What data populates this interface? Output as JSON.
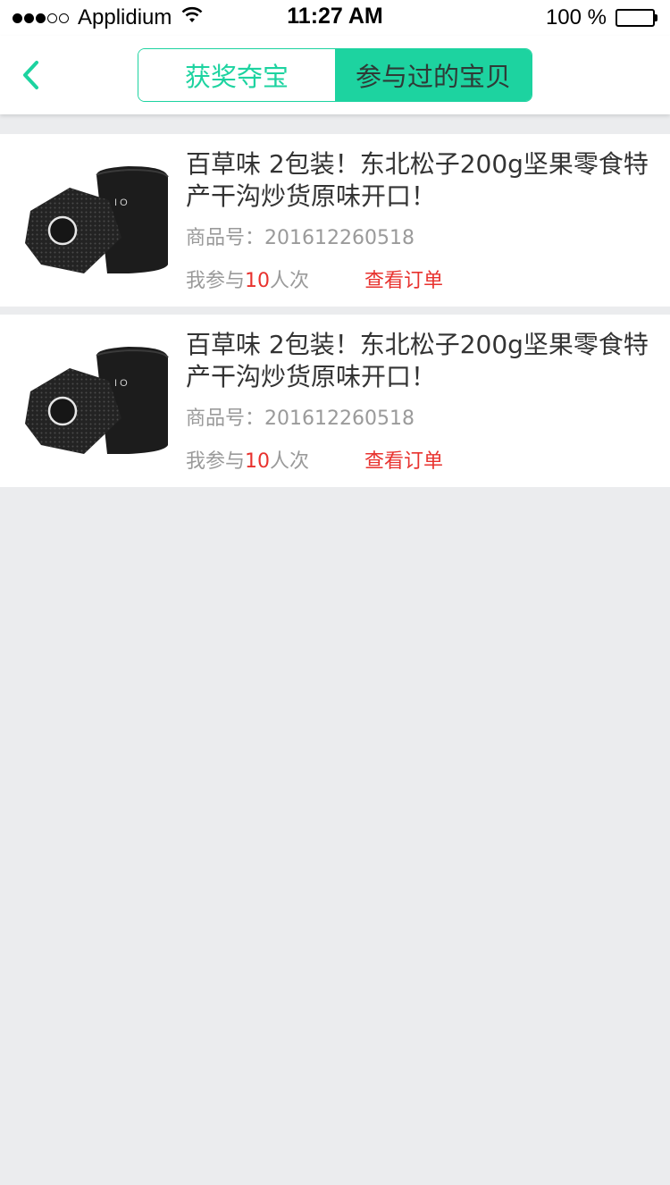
{
  "status_bar": {
    "carrier": "Applidium",
    "time": "11:27 AM",
    "battery": "100 %",
    "signal_bars_filled": 3,
    "signal_bars_total": 5
  },
  "nav": {
    "tabs": [
      {
        "label": "获奖夺宝",
        "active": false
      },
      {
        "label": "参与过的宝贝",
        "active": true
      }
    ],
    "accent_color": "#1dd3a0"
  },
  "items": [
    {
      "title": "百草味 2包装！东北松子200g坚果零食特产干沟炒货原味开口！",
      "code_label": "商品号：",
      "code": "201612260518",
      "participate_prefix": "我参与 ",
      "participate_count": "10",
      "participate_suffix": "人次",
      "order_link": "查看订单"
    },
    {
      "title": "百草味 2包装！东北松子200g坚果零食特产干沟炒货原味开口！",
      "code_label": "商品号：",
      "code": "201612260518",
      "participate_prefix": "我参与 ",
      "participate_count": "10",
      "participate_suffix": "人次",
      "order_link": "查看订单"
    }
  ],
  "colors": {
    "highlight_red": "#e8322e",
    "background": "#ebecee"
  },
  "icons": {
    "back": "chevron-left-icon",
    "product": "speaker-image"
  }
}
